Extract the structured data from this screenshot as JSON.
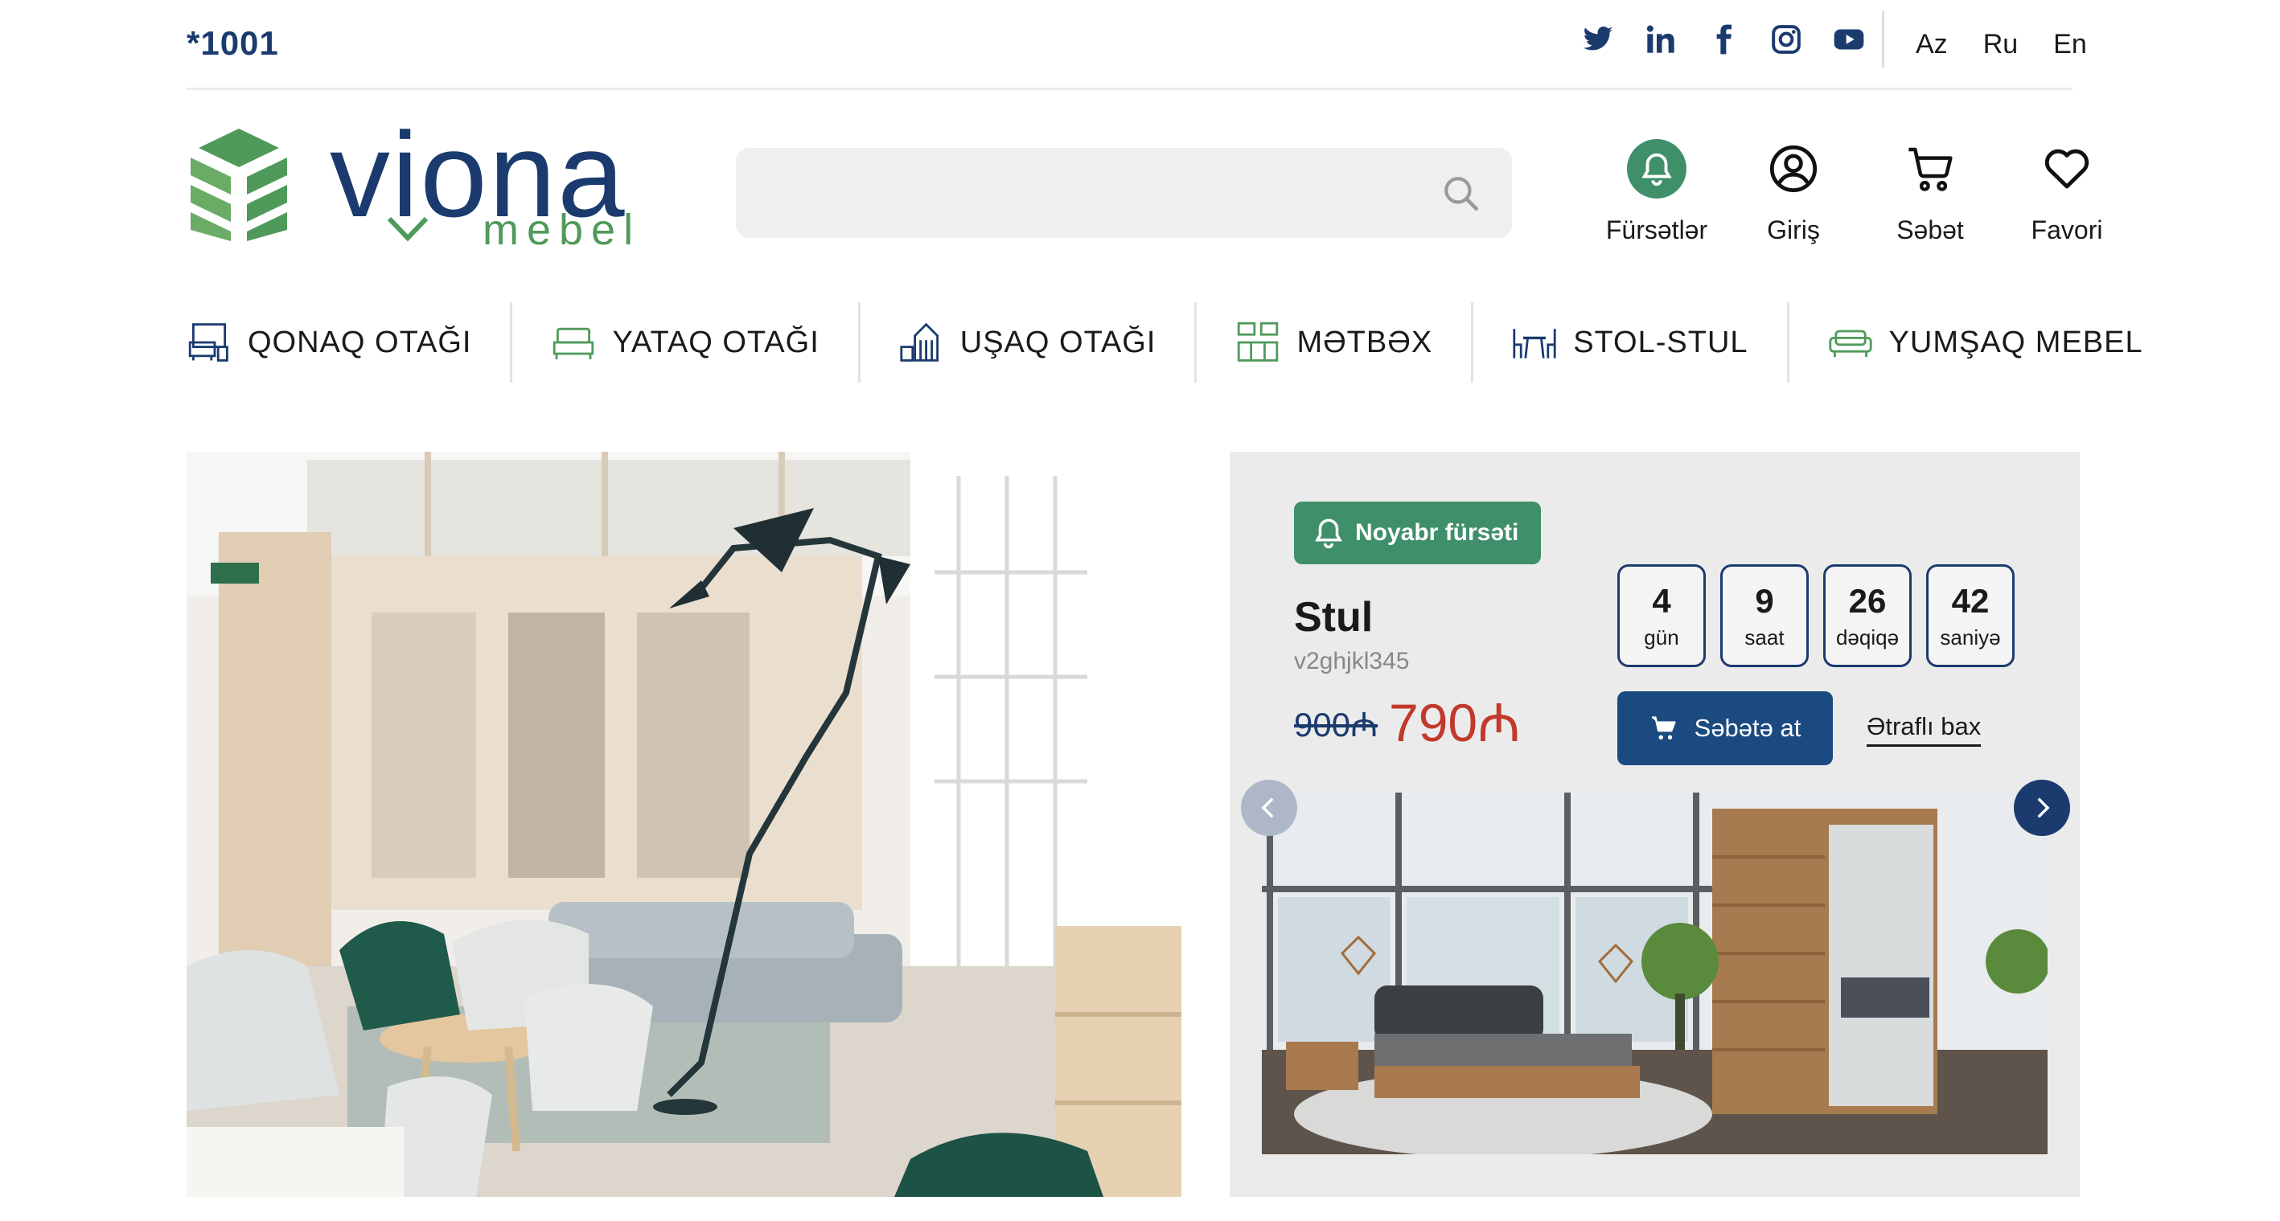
{
  "topbar": {
    "hotline": "*1001",
    "socials": [
      "twitter-icon",
      "linkedin-icon",
      "facebook-icon",
      "instagram-icon",
      "youtube-icon"
    ],
    "languages": [
      "Az",
      "Ru",
      "En"
    ]
  },
  "header": {
    "logo_word": "viona",
    "logo_sub": "mebel",
    "search_placeholder": "",
    "icons": {
      "offers": "Fürsətlər",
      "login": "Giriş",
      "cart": "Səbət",
      "favorites": "Favori"
    }
  },
  "categories": [
    {
      "label": "QONAQ OTAĞI",
      "icon": "living-room-icon"
    },
    {
      "label": "YATAQ OTAĞI",
      "icon": "bed-icon"
    },
    {
      "label": "UŞAQ OTAĞI",
      "icon": "kids-room-icon"
    },
    {
      "label": "MƏTBƏX",
      "icon": "kitchen-icon"
    },
    {
      "label": "STOL-STUL",
      "icon": "table-chair-icon"
    },
    {
      "label": "YUMŞAQ MEBEL",
      "icon": "sofa-icon"
    }
  ],
  "deal": {
    "badge": "Noyabr fürsəti",
    "product_name": "Stul",
    "product_code": "v2ghjkl345",
    "old_price": "900₼",
    "new_price": "790₼",
    "timer": [
      {
        "value": "4",
        "unit": "gün"
      },
      {
        "value": "9",
        "unit": "saat"
      },
      {
        "value": "26",
        "unit": "dəqiqə"
      },
      {
        "value": "42",
        "unit": "saniyə"
      }
    ],
    "add_to_cart": "Səbətə at",
    "details_link": "Ətraflı bax"
  },
  "colors": {
    "brand_blue": "#1b3b6f",
    "brand_green": "#3f8f6b",
    "price_red": "#c0392b",
    "panel_bg": "#ebebeb"
  }
}
